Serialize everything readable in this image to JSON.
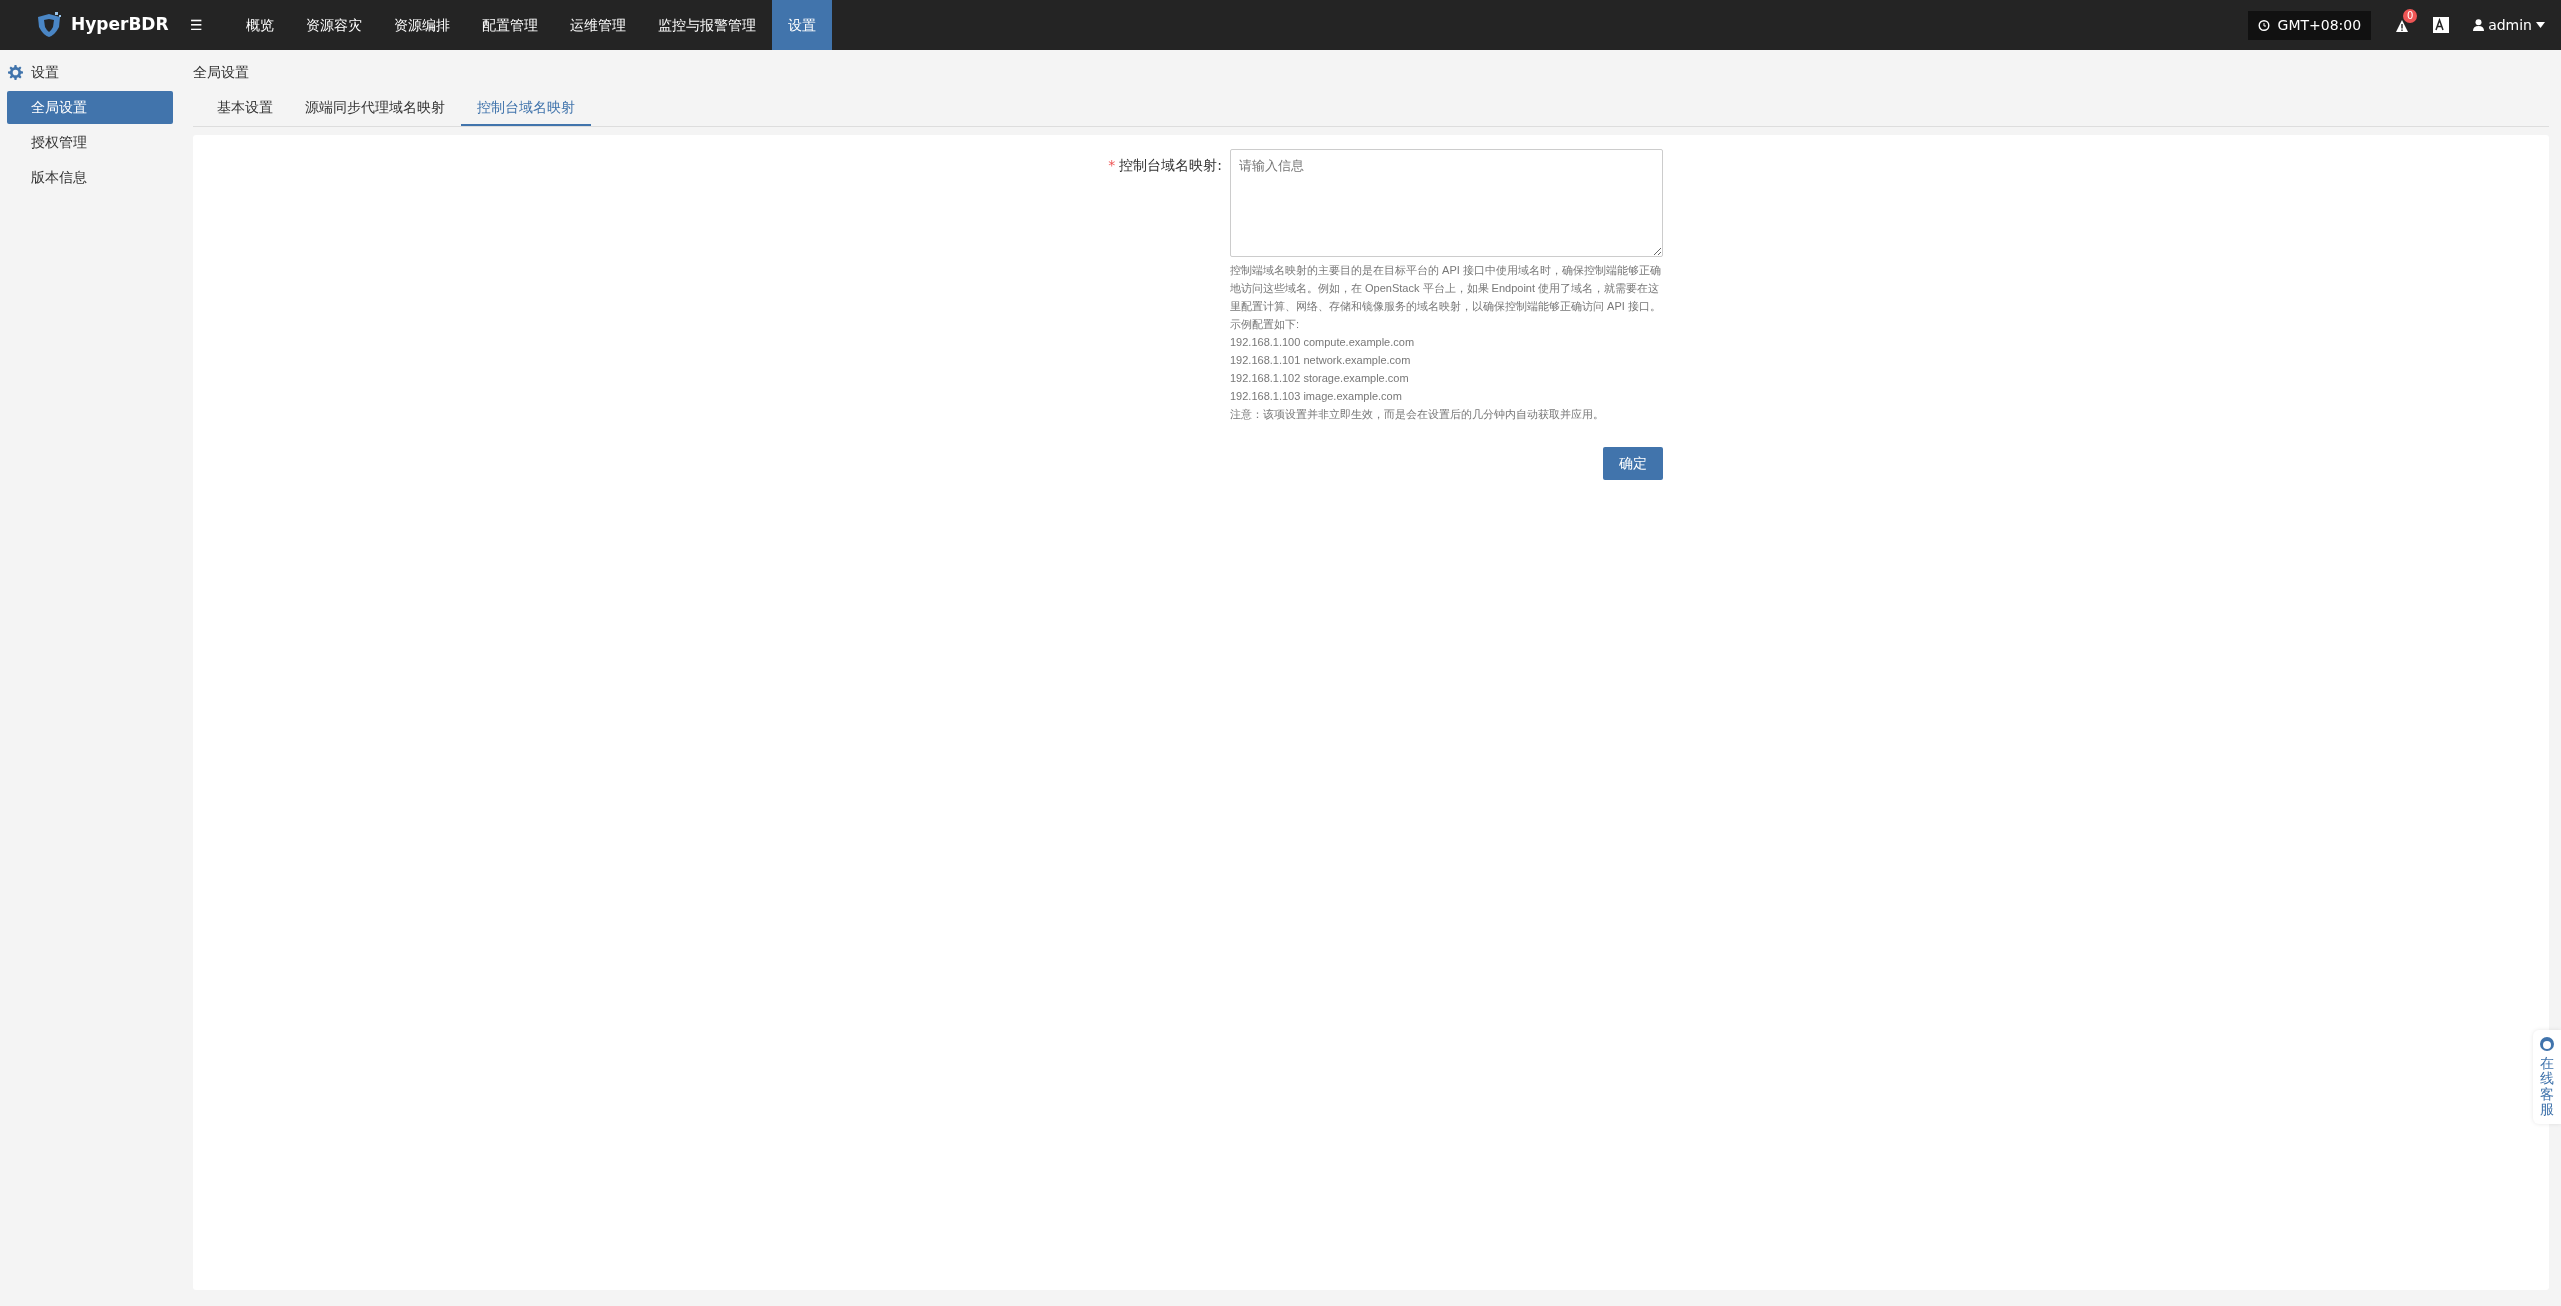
{
  "navbar": {
    "brand": "HyperBDR",
    "menu_icon": "☰",
    "items": [
      {
        "label": "概览",
        "selected": false
      },
      {
        "label": "资源容灾",
        "selected": false
      },
      {
        "label": "资源编排",
        "selected": false
      },
      {
        "label": "配置管理",
        "selected": false
      },
      {
        "label": "运维管理",
        "selected": false
      },
      {
        "label": "监控与报警管理",
        "selected": false
      },
      {
        "label": "设置",
        "selected": true
      }
    ],
    "timezone": "GMT+08:00",
    "alert_count": "0",
    "user": "admin"
  },
  "sidebar": {
    "title": "设置",
    "items": [
      {
        "label": "全局设置",
        "selected": true
      },
      {
        "label": "授权管理",
        "selected": false
      },
      {
        "label": "版本信息",
        "selected": false
      }
    ]
  },
  "page_title": "全局设置",
  "tabs": [
    {
      "label": "基本设置",
      "selected": false
    },
    {
      "label": "源端同步代理域名映射",
      "selected": false
    },
    {
      "label": "控制台域名映射",
      "selected": true
    }
  ],
  "form": {
    "label": "控制台域名映射:",
    "required_mark": "*",
    "placeholder": "请输入信息",
    "help": [
      "控制端域名映射的主要目的是在目标平台的 API 接口中使用域名时，确保控制端能够正确地访问这些域名。例如，在 OpenStack 平台上，如果 Endpoint 使用了域名，就需要在这里配置计算、网络、存储和镜像服务的域名映射，以确保控制端能够正确访问 API 接口。",
      "示例配置如下:",
      "192.168.1.100 compute.example.com",
      "192.168.1.101 network.example.com",
      "192.168.1.102 storage.example.com",
      "192.168.1.103 image.example.com",
      "注意：该项设置并非立即生效，而是会在设置后的几分钟内自动获取并应用。"
    ],
    "submit": "确定"
  },
  "chat_widget": "在线客服"
}
